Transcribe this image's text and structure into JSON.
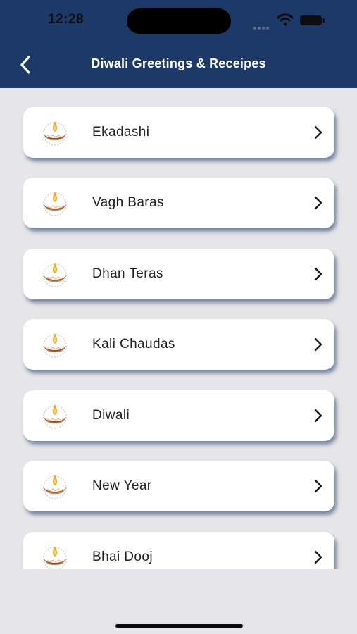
{
  "status_bar": {
    "time": "12:28"
  },
  "header": {
    "title": "Diwali Greetings & Receipes",
    "back_icon": "chevron-left-icon"
  },
  "colors": {
    "header_bg": "#1c3967",
    "page_bg": "#e6e6e8",
    "card_bg": "#ffffff",
    "card_shadow": "#1c3967"
  },
  "items": [
    {
      "label": "Ekadashi",
      "icon": "diya-icon"
    },
    {
      "label": "Vagh Baras",
      "icon": "diya-icon"
    },
    {
      "label": "Dhan Teras",
      "icon": "diya-icon"
    },
    {
      "label": "Kali Chaudas",
      "icon": "diya-icon"
    },
    {
      "label": "Diwali",
      "icon": "diya-icon"
    },
    {
      "label": "New Year",
      "icon": "diya-icon"
    },
    {
      "label": "Bhai Dooj",
      "icon": "diya-icon"
    }
  ]
}
